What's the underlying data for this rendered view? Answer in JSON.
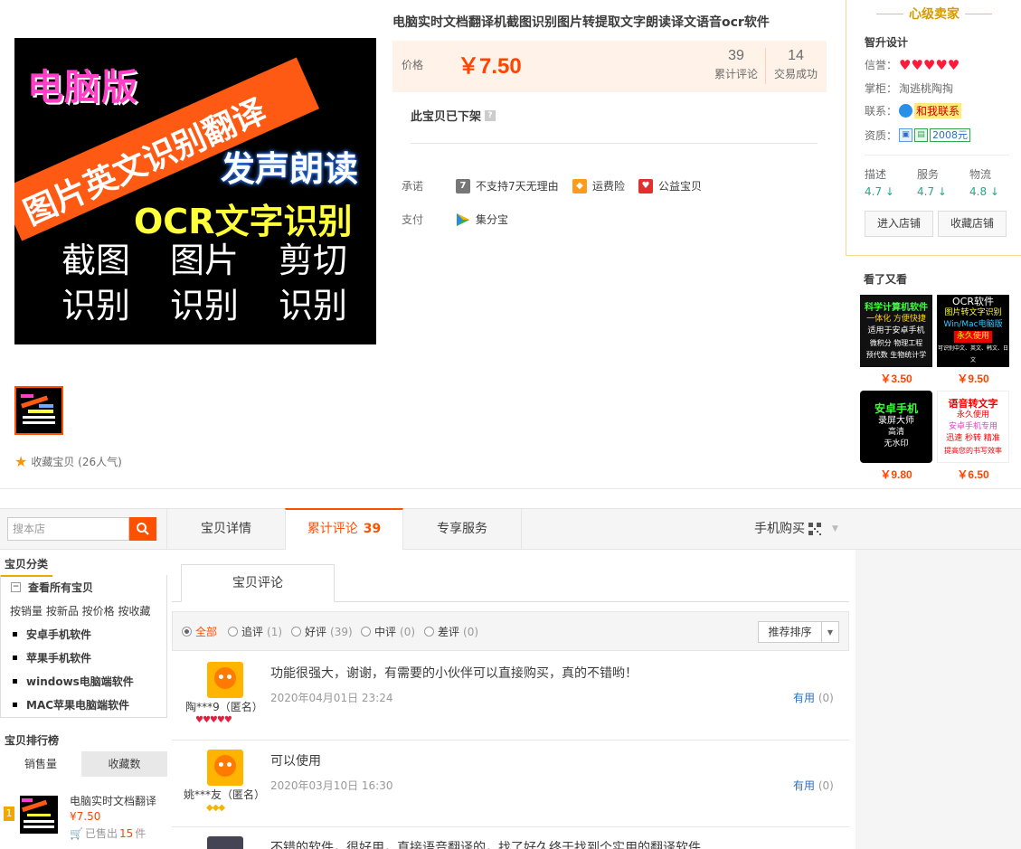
{
  "product": {
    "title": "电脑实时文档翻译机截图识别图片转提取文字朗读译文语音ocr软件",
    "price_label": "价格",
    "price": "￥7.50",
    "reviews_count": "39",
    "reviews_label": "累计评论",
    "deals_count": "14",
    "deals_label": "交易成功",
    "offline": "此宝贝已下架",
    "promise_label": "承诺",
    "promises": [
      "不支持7天无理由",
      "运费险",
      "公益宝贝"
    ],
    "pay_label": "支付",
    "pay_method": "集分宝",
    "favorite": "收藏宝贝 (26人气)"
  },
  "main_image": {
    "line1": "电脑版",
    "band": "图片英文识别翻译",
    "line3": "发声朗读",
    "line4": "OCR文字识别",
    "grid": [
      "截图",
      "图片",
      "剪切",
      "识别",
      "识别",
      "识别"
    ]
  },
  "seller": {
    "header": "心级卖家",
    "name": "智升设计",
    "credit_label": "信誉：",
    "keeper_label": "掌柜：",
    "keeper": "淘逃桃陶掏",
    "contact_label": "联系：",
    "contact": "和我联系",
    "qual_label": "资质：",
    "qual_money": "2008元",
    "dsr": [
      {
        "label": "描述",
        "value": "4.7"
      },
      {
        "label": "服务",
        "value": "4.7"
      },
      {
        "label": "物流",
        "value": "4.8"
      }
    ],
    "enter_shop": "进入店铺",
    "fav_shop": "收藏店铺"
  },
  "also_viewed": {
    "title": "看了又看",
    "items": [
      {
        "price": "￥3.50",
        "lines": [
          "科学计算机软件",
          "一体化 方便快捷",
          "适用于安卓手机",
          "微积分  物理工程",
          "预代数  生物统计学"
        ]
      },
      {
        "price": "￥9.50",
        "lines": [
          "OCR软件",
          "图片转文字识别",
          "Win/Mac电脑版",
          "永久使用",
          "可识别中文、英文、韩文、日文"
        ]
      },
      {
        "price": "￥9.80",
        "lines": [
          "安卓手机",
          "录屏大师",
          "高清",
          "无水印"
        ]
      },
      {
        "price": "￥6.50",
        "lines": [
          "语音转文字",
          "永久使用",
          "安卓手机专用",
          "迅速 秒转 精准",
          "提高您的书写效率"
        ]
      }
    ]
  },
  "tabs": {
    "search_placeholder": "搜本店",
    "detail": "宝贝详情",
    "reviews": "累计评论",
    "reviews_count": "39",
    "service": "专享服务",
    "mobile": "手机购买"
  },
  "sidebar": {
    "category_title": "宝贝分类",
    "all": "查看所有宝贝",
    "sorts": "按销量 按新品 按价格 按收藏",
    "categories": [
      "安卓手机软件",
      "苹果手机软件",
      "windows电脑端软件",
      "MAC苹果电脑端软件"
    ],
    "rank_title": "宝贝排行榜",
    "rank_tab_sales": "销售量",
    "rank_tab_fav": "收藏数",
    "rank_num": "1",
    "rank_item": "电脑实时文档翻译",
    "rank_price": "¥7.50",
    "rank_sold_pre": "已售出",
    "rank_sold_num": "15",
    "rank_sold_post": "件"
  },
  "reviews": {
    "tab": "宝贝评论",
    "filters": [
      {
        "label": "全部",
        "count": ""
      },
      {
        "label": "追评",
        "count": "(1)"
      },
      {
        "label": "好评",
        "count": "(39)"
      },
      {
        "label": "中评",
        "count": "(0)"
      },
      {
        "label": "差评",
        "count": "(0)"
      }
    ],
    "sort": "推荐排序",
    "items": [
      {
        "user": "陶***9（匿名）",
        "text": "功能很强大，谢谢，有需要的小伙伴可以直接购买，真的不错哟！",
        "date": "2020年04月01日 23:24",
        "useful": "有用",
        "useful_count": "(0)"
      },
      {
        "user": "姚***友（匿名）",
        "text": "可以使用",
        "date": "2020年03月10日 16:30",
        "useful": "有用",
        "useful_count": "(0)"
      },
      {
        "text": "不错的软件，很好用，直接语音翻译的，找了好久终于找到个实用的翻译软件"
      }
    ]
  }
}
